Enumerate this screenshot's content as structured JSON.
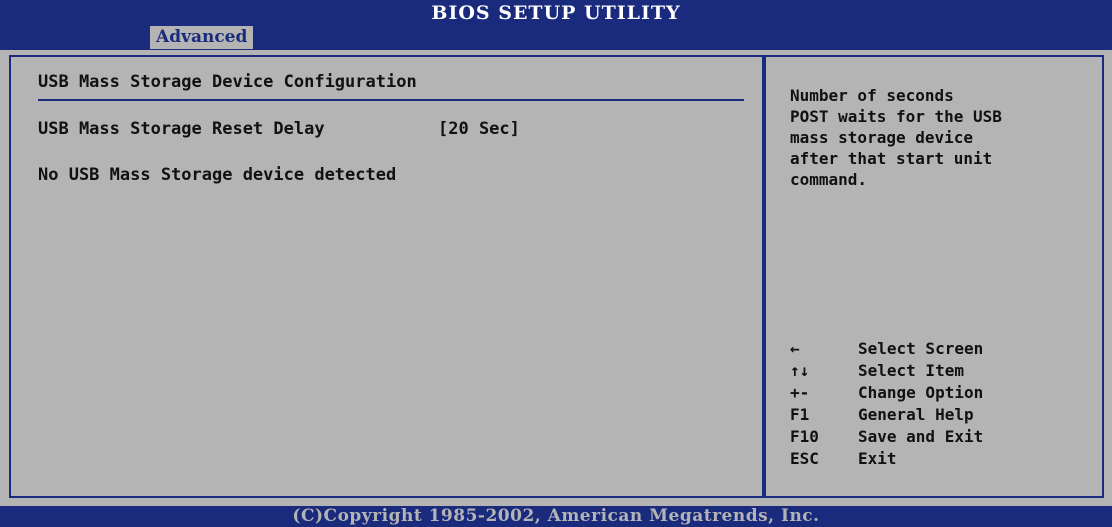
{
  "header": {
    "title": "BIOS SETUP UTILITY",
    "active_tab": "Advanced"
  },
  "main": {
    "section_title": "USB Mass Storage Device Configuration",
    "settings": [
      {
        "label": "USB Mass Storage Reset Delay",
        "value": "[20 Sec]"
      }
    ],
    "status_text": "No USB Mass Storage device detected"
  },
  "help": {
    "lines": [
      "Number of seconds",
      "POST waits for the USB",
      "mass storage device",
      "after that start unit",
      "command."
    ]
  },
  "keys": [
    {
      "key": "←",
      "key_icon": "arrow-left-icon",
      "desc": "Select Screen"
    },
    {
      "key": "↑↓",
      "key_icon": "arrow-up-down-icon",
      "desc": "Select Item"
    },
    {
      "key": "+-",
      "desc": "Change Option"
    },
    {
      "key": "F1",
      "desc": "General Help"
    },
    {
      "key": "F10",
      "desc": "Save and Exit"
    },
    {
      "key": "ESC",
      "desc": "Exit"
    }
  ],
  "footer": {
    "copyright": "(C)Copyright 1985-2002, American Megatrends, Inc."
  },
  "colors": {
    "bar": "#1a2a7c",
    "panel": "#b4b4b4",
    "text": "#111111"
  }
}
